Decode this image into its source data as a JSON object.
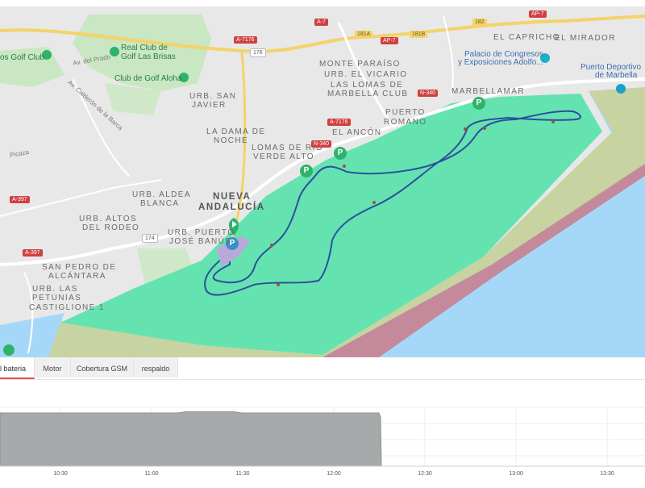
{
  "tabs": [
    {
      "label": "l bateria",
      "active": true
    },
    {
      "label": "Motor",
      "active": false
    },
    {
      "label": "Cobertura GSM",
      "active": false
    },
    {
      "label": "respaldo",
      "active": false
    }
  ],
  "map": {
    "places": [
      {
        "key": "el_mirador",
        "text": "EL MIRADOR"
      },
      {
        "key": "el_capricho",
        "text": "EL CAPRICHO"
      },
      {
        "key": "monte_paraiso",
        "text": "MONTE PARAÍSO"
      },
      {
        "key": "urb_el_vicario",
        "text": "URB. EL VICARIO"
      },
      {
        "key": "lomas1",
        "text": "LAS LOMAS DE"
      },
      {
        "key": "lomas2",
        "text": "MARBELLA CLUB"
      },
      {
        "key": "marbellamar",
        "text": "MARBELLAMAR"
      },
      {
        "key": "puerto_romano1",
        "text": "PUERTO"
      },
      {
        "key": "puerto_romano2",
        "text": "ROMANO"
      },
      {
        "key": "el_ancon",
        "text": "EL ANCÓN"
      },
      {
        "key": "urb_san_javier1",
        "text": "URB. SAN"
      },
      {
        "key": "urb_san_javier2",
        "text": "JAVIER"
      },
      {
        "key": "dama1",
        "text": "LA DAMA DE"
      },
      {
        "key": "dama2",
        "text": "NOCHE"
      },
      {
        "key": "lomas_rio1",
        "text": "LOMAS DE RÍO"
      },
      {
        "key": "lomas_rio2",
        "text": "VERDE ALTO"
      },
      {
        "key": "nueva1",
        "text": "NUEVA"
      },
      {
        "key": "nueva2",
        "text": "ANDALUCÍA"
      },
      {
        "key": "aldea1",
        "text": "URB. ALDEA"
      },
      {
        "key": "aldea2",
        "text": "BLANCA"
      },
      {
        "key": "altos1",
        "text": "URB. ALTOS"
      },
      {
        "key": "altos2",
        "text": "DEL RODEO"
      },
      {
        "key": "banus1",
        "text": "URB. PUERTO"
      },
      {
        "key": "banus2",
        "text": "JOSÉ BANÚS"
      },
      {
        "key": "san_pedro1",
        "text": "SAN PEDRO DE"
      },
      {
        "key": "san_pedro2",
        "text": "ALCÁNTARA"
      },
      {
        "key": "petunias1",
        "text": "URB. LAS"
      },
      {
        "key": "petunias2",
        "text": "PETUNIAS"
      },
      {
        "key": "castiglione",
        "text": "CASTIGLIONE 1"
      }
    ],
    "pois": [
      {
        "key": "golf_club",
        "text": "os Golf Club"
      },
      {
        "key": "real_club1",
        "text": "Real Club de"
      },
      {
        "key": "real_club2",
        "text": "Golf Las Brisas"
      },
      {
        "key": "aloha",
        "text": "Club de Golf Aloha"
      },
      {
        "key": "palacio1",
        "text": "Palacio de Congresos"
      },
      {
        "key": "palacio2",
        "text": "y Exposiciones Adolfo..."
      },
      {
        "key": "puerto_dep1",
        "text": "Puerto Deportivo"
      },
      {
        "key": "puerto_dep2",
        "text": "de Marbella"
      }
    ],
    "streets": [
      {
        "key": "av_prado",
        "text": "Av. del Prado"
      },
      {
        "key": "av_calderon",
        "text": "Av. Calderón de la Barca"
      },
      {
        "key": "picaza",
        "text": "Picaza"
      }
    ],
    "road_shields": [
      {
        "key": "a7",
        "text": "A-7"
      },
      {
        "key": "a7176a",
        "text": "A-7176"
      },
      {
        "key": "r176",
        "text": "176"
      },
      {
        "key": "r181a",
        "text": "181A"
      },
      {
        "key": "ap7a",
        "text": "AP-7"
      },
      {
        "key": "r181b",
        "text": "181B"
      },
      {
        "key": "r182",
        "text": "182"
      },
      {
        "key": "ap7b",
        "text": "AP-7"
      },
      {
        "key": "n340a",
        "text": "N-340"
      },
      {
        "key": "a7176b",
        "text": "A-7176"
      },
      {
        "key": "n340b",
        "text": "N-340"
      },
      {
        "key": "r174",
        "text": "174"
      },
      {
        "key": "a397a",
        "text": "A-397"
      },
      {
        "key": "a397b",
        "text": "A-397"
      }
    ],
    "parking_marker_letter": "P",
    "colors": {
      "land": "#e8e8e8",
      "water": "#a5d8f8",
      "zone_green": "#64e3b0",
      "zone_olive": "#c7d3a0",
      "zone_maroon": "#c48a9c",
      "route": "#2d4f9e",
      "marker": "#2fb36b",
      "highway": "#f3d36a"
    }
  },
  "chart": {
    "x_ticks": [
      "10:30",
      "11:00",
      "11:30",
      "12:00",
      "12:30",
      "13:00",
      "13:30"
    ],
    "fill_color": "#a7aaab"
  }
}
